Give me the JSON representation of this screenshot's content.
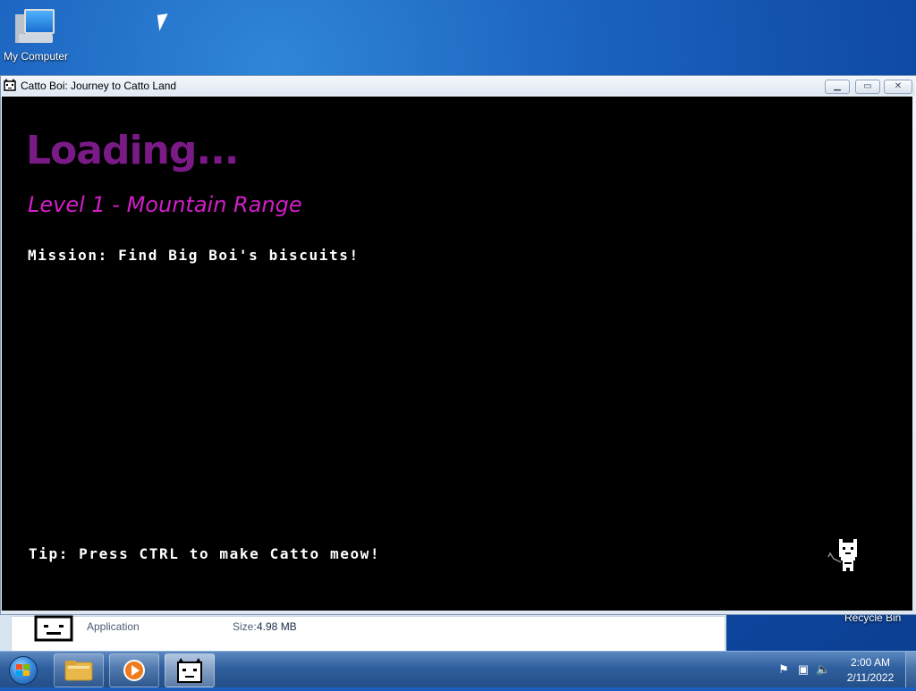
{
  "desktop": {
    "icons": [
      {
        "label": "My Computer",
        "icon": "computer-icon"
      }
    ]
  },
  "game_window": {
    "title": "Catto Boi: Journey to Catto Land",
    "icon": "cat-face-icon",
    "buttons": {
      "minimize": "minimize-icon",
      "maximize": "maximize-icon",
      "close": "close-icon"
    },
    "content": {
      "loading": "Loading...",
      "level": "Level 1 - Mountain Range",
      "mission": "Mission: Find Big Boi's biscuits!",
      "tip": "Tip: Press CTRL to make Catto meow!",
      "sprite": "cat-sprite-icon"
    },
    "colors": {
      "loading": "#7a1a86",
      "level": "#d21ec8",
      "text": "#ffffff",
      "background": "#000000"
    }
  },
  "details_pane": {
    "type": "Application",
    "size_label": "Size:",
    "size_value": "4.98 MB"
  },
  "recycle_bin": {
    "label": "Recycle Bin"
  },
  "taskbar": {
    "start": "windows-start-icon",
    "pinned": [
      "folder-icon",
      "media-player-icon",
      "cat-face-icon"
    ],
    "tray_icons": [
      "action-center-icon",
      "network-icon",
      "volume-icon"
    ],
    "clock": {
      "time": "2:00 AM",
      "date": "2/11/2022"
    }
  }
}
